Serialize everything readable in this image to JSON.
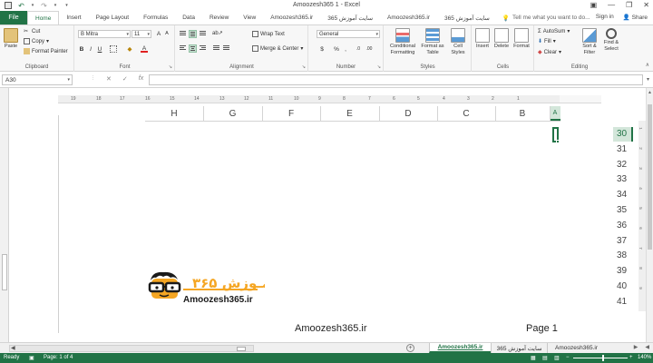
{
  "window": {
    "title": "Amoozesh365 1 - Excel"
  },
  "tabs": {
    "file": "File",
    "items": [
      "Home",
      "Insert",
      "Page Layout",
      "Formulas",
      "Data",
      "Review",
      "View",
      "Amoozesh365.ir",
      "سایت آموزش 365",
      "Amoozesh365.ir",
      "سایت آموزش 365"
    ],
    "active": "Home",
    "tell_me": "Tell me what you want to do...",
    "sign_in": "Sign in",
    "share": "Share"
  },
  "ribbon": {
    "clipboard": {
      "paste": "Paste",
      "cut": "Cut",
      "copy": "Copy",
      "format_painter": "Format Painter",
      "label": "Clipboard"
    },
    "font": {
      "name": "B Mitra",
      "size": "11",
      "label": "Font",
      "bold": "B",
      "italic": "I",
      "underline": "U",
      "grow": "A",
      "shrink": "A",
      "font_color": "A"
    },
    "alignment": {
      "wrap": "Wrap Text",
      "merge": "Merge & Center",
      "label": "Alignment"
    },
    "number": {
      "format": "General",
      "currency": "$",
      "percent": "%",
      "comma": ",",
      "label": "Number"
    },
    "styles": {
      "conditional": "Conditional\nFormatting",
      "format_table": "Format as\nTable",
      "cell_styles": "Cell\nStyles",
      "label": "Styles"
    },
    "cells": {
      "insert": "Insert",
      "delete": "Delete",
      "format": "Format",
      "label": "Cells"
    },
    "editing": {
      "autosum": "AutoSum",
      "fill": "Fill",
      "clear": "Clear",
      "sort": "Sort &\nFilter",
      "find": "Find &\nSelect",
      "label": "Editing"
    }
  },
  "formula_bar": {
    "name_box": "A30",
    "value": ""
  },
  "ruler_top": [
    "19",
    "18",
    "17",
    "16",
    "15",
    "14",
    "13",
    "12",
    "11",
    "10",
    "9",
    "8",
    "7",
    "6",
    "5",
    "4",
    "3",
    "2",
    "1"
  ],
  "columns": [
    "H",
    "G",
    "F",
    "E",
    "D",
    "C",
    "B",
    "A"
  ],
  "rows": [
    "30",
    "31",
    "32",
    "33",
    "34",
    "35",
    "36",
    "37",
    "38",
    "39",
    "40",
    "41"
  ],
  "selected_row": "30",
  "vruler": [
    "1",
    "2",
    "3",
    "4",
    "5",
    "6",
    "7",
    "8",
    "9"
  ],
  "logo": {
    "persian": "آمـوزش ۳۶۵",
    "latin": "Amoozesh365.ir"
  },
  "footer": {
    "left": "Amoozesh365.ir",
    "right": "Page 1"
  },
  "sheets": {
    "items": [
      "Amoozesh365.ir",
      "سایت آموزش 365",
      "Amoozesh365.ir"
    ],
    "active_index": 0
  },
  "status": {
    "ready": "Ready",
    "page": "Page: 1 of 4",
    "zoom": "140%"
  },
  "colors": {
    "accent": "#217346",
    "logo_orange": "#f5a623",
    "logo_dark": "#1a1a1a"
  }
}
